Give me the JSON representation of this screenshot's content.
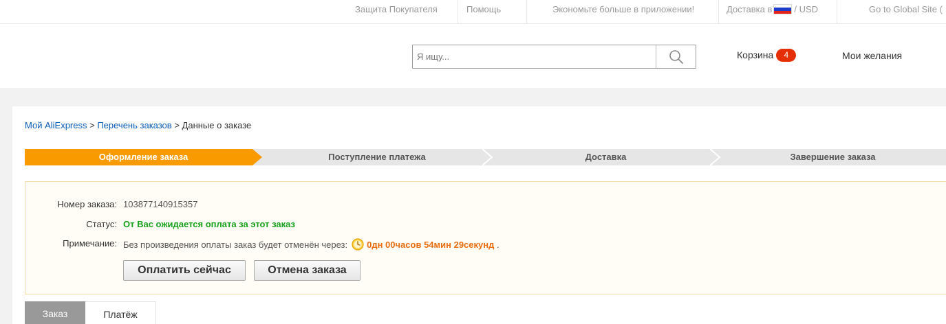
{
  "topbar": {
    "buyer_protection": "Защита Покупателя",
    "help": "Помощь",
    "app_promo": "Экономьте больше в приложении!",
    "ship_to": "Доставка в",
    "currency": "/ USD",
    "global_site": "Go to Global Site ("
  },
  "header": {
    "search_placeholder": "Я ищу...",
    "cart_label": "Корзина",
    "cart_count": "4",
    "wishlist": "Мои желания"
  },
  "breadcrumb": {
    "root": "Мой AliExpress",
    "sep1": " > ",
    "list": "Перечень заказов",
    "sep2": " > ",
    "current": "Данные о заказе"
  },
  "steps": [
    {
      "label": "Оформление заказа",
      "active": true
    },
    {
      "label": "Поступление платежа",
      "active": false
    },
    {
      "label": "Доставка",
      "active": false
    },
    {
      "label": "Завершение заказа",
      "active": false
    }
  ],
  "order": {
    "number_label": "Номер заказа:",
    "number_value": "103877140915357",
    "status_label": "Статус:",
    "status_value": "От Вас ожидается оплата за этот заказ",
    "note_label": "Примечание:",
    "note_value": "Без произведения оплаты заказ будет отменён через:",
    "timer": "0дн 00часов 54мин 29секунд",
    "timer_suffix": ".",
    "pay_button": "Оплатить сейчас",
    "cancel_button": "Отмена заказа"
  },
  "tabs": {
    "order": "Заказ",
    "payment": "Платёж"
  },
  "colors": {
    "accent_orange": "#f99a00",
    "status_green": "#16a01c",
    "timer_orange": "#e86d0f",
    "badge_red": "#e62e04",
    "link_blue": "#0a5db7"
  }
}
